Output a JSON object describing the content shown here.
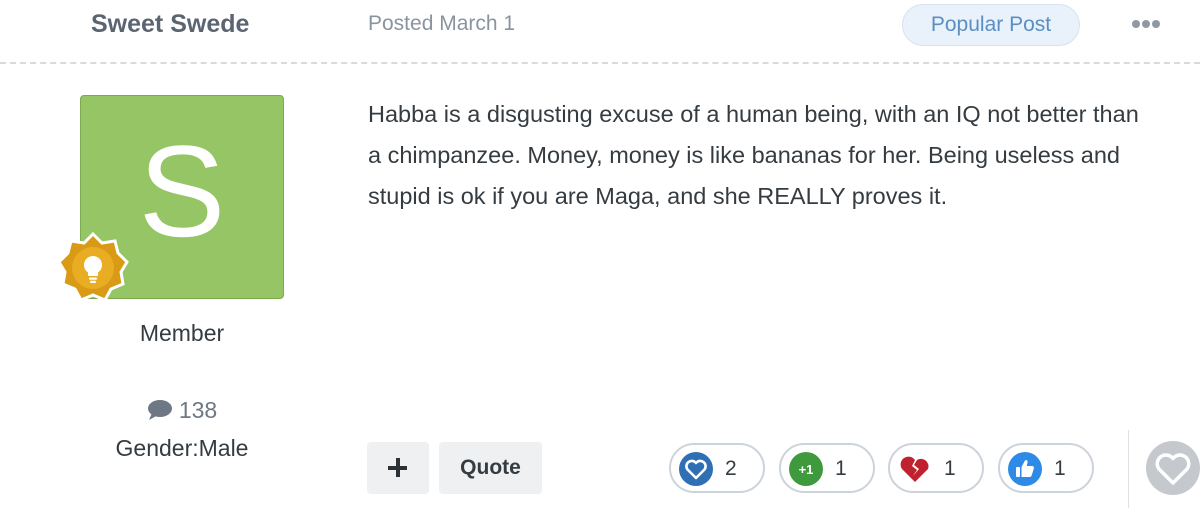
{
  "post": {
    "author": "Sweet Swede",
    "posted": "Posted March 1",
    "popular_badge": "Popular Post",
    "menu_icon": "ellipsis-icon",
    "body": "Habba is a disgusting excuse of a human being, with an IQ not better than a chimpanzee. Money, money is like bananas for her. Being useless and stupid is ok if you are Maga, and she REALLY proves it."
  },
  "author_panel": {
    "avatar_letter": "S",
    "avatar_color": "#95c564",
    "badge_icon": "lightbulb-icon",
    "rank": "Member",
    "post_count": "138",
    "post_count_icon": "comment-icon",
    "gender_label": "Gender:",
    "gender_value": "Male"
  },
  "actions": {
    "plus_icon": "plus-icon",
    "quote_label": "Quote"
  },
  "reactions": [
    {
      "icon": "heart-icon",
      "count": "2",
      "color": "#2f6fb3"
    },
    {
      "icon": "plus-one-icon",
      "label": "+1",
      "count": "1",
      "color": "#3f9a3e"
    },
    {
      "icon": "broken-heart-icon",
      "count": "1",
      "color": "#c0212f"
    },
    {
      "icon": "thumbs-up-icon",
      "count": "1",
      "color": "#2d8ae6"
    }
  ],
  "react_button_icon": "heart-outline-icon"
}
